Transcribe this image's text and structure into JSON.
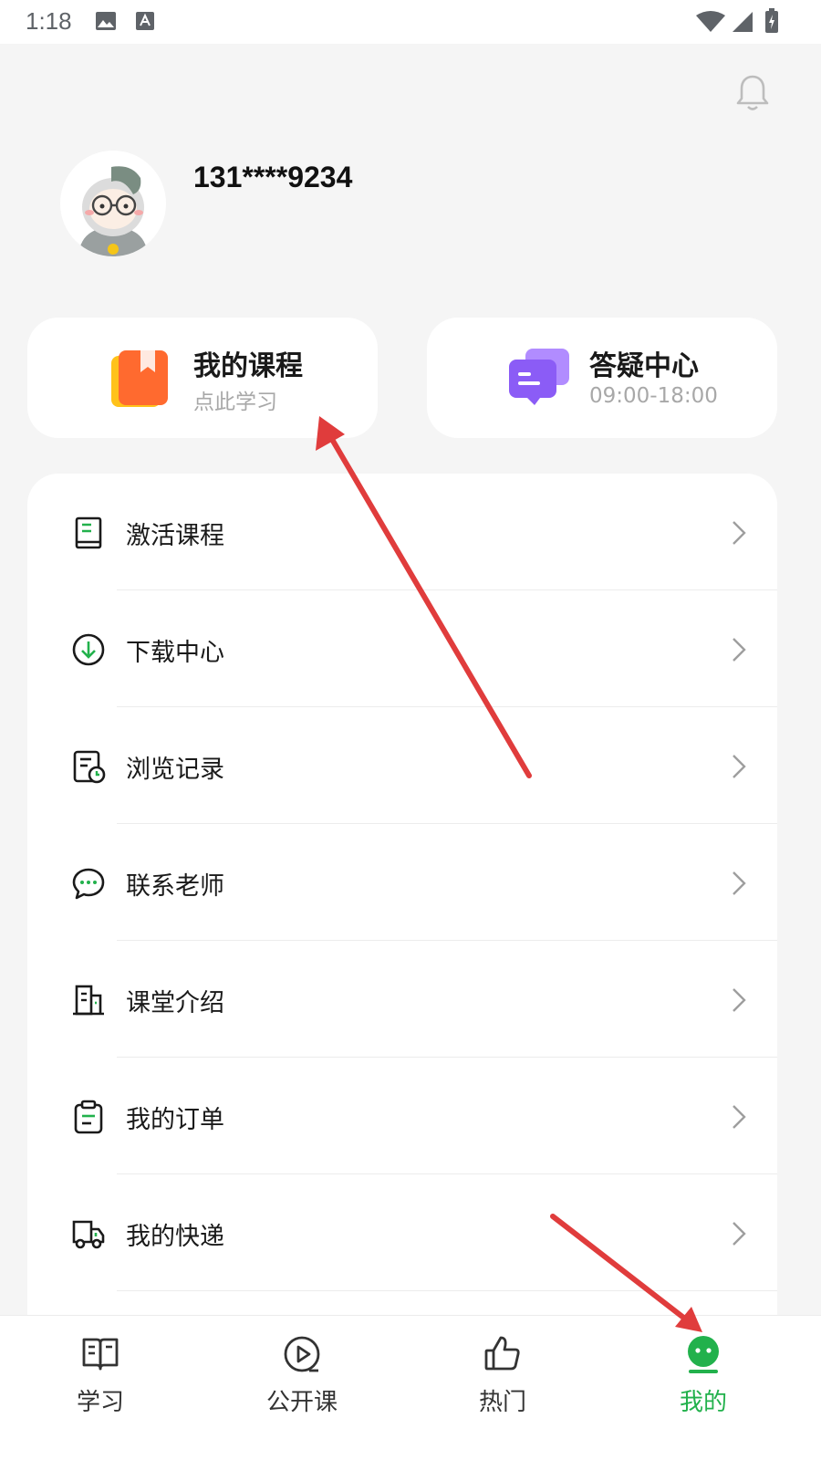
{
  "status_bar": {
    "time": "1:18"
  },
  "profile": {
    "phone": "131****9234"
  },
  "cards": [
    {
      "title": "我的课程",
      "subtitle": "点此学习",
      "icon": "bookmark-book-icon"
    },
    {
      "title": "答疑中心",
      "subtitle": "09:00-18:00",
      "icon": "chat-bubbles-icon"
    }
  ],
  "menu": {
    "items": [
      {
        "label": "激活课程",
        "icon": "book-icon"
      },
      {
        "label": "下载中心",
        "icon": "download-circle-icon"
      },
      {
        "label": "浏览记录",
        "icon": "history-doc-icon"
      },
      {
        "label": "联系老师",
        "icon": "chat-icon"
      },
      {
        "label": "课堂介绍",
        "icon": "building-icon"
      },
      {
        "label": "我的订单",
        "icon": "clipboard-icon"
      },
      {
        "label": "我的快递",
        "icon": "truck-icon"
      }
    ]
  },
  "tabbar": {
    "tabs": [
      {
        "label": "学习",
        "icon": "open-book-icon"
      },
      {
        "label": "公开课",
        "icon": "play-circle-icon"
      },
      {
        "label": "热门",
        "icon": "thumbs-up-icon"
      },
      {
        "label": "我的",
        "icon": "smile-face-icon",
        "active": true
      }
    ]
  },
  "colors": {
    "accent_green": "#22b14c",
    "arrow_red": "#e03c3c",
    "course_card_orange": "#ff6a2f",
    "qa_card_purple": "#8b5cf6"
  }
}
